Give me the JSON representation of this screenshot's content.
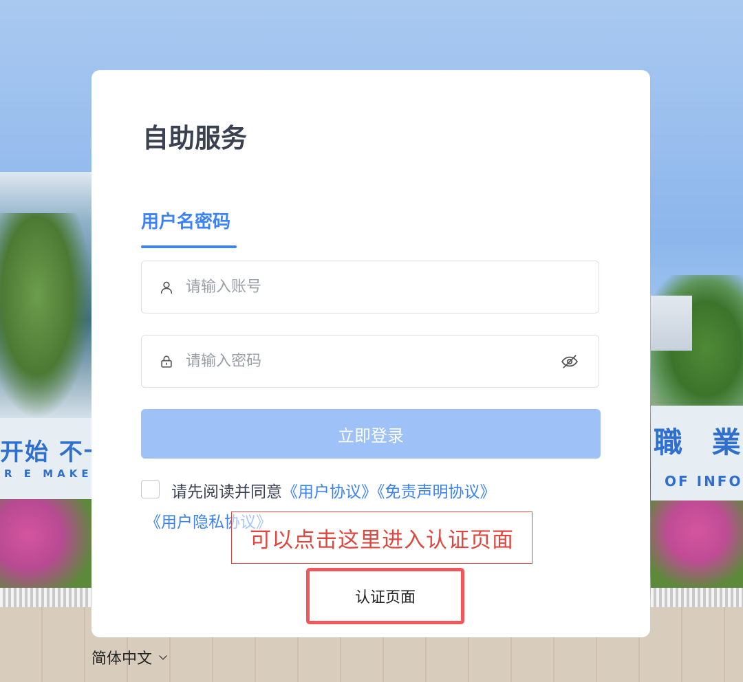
{
  "background": {
    "sign_left_big": "开始 不一",
    "sign_left_small": "R E  MAKE",
    "sign_right_big": "職 業",
    "sign_right_small": "OF  INFO"
  },
  "card": {
    "title": "自助服务",
    "tab_label": "用户名密码",
    "username": {
      "placeholder": "请输入账号",
      "icon": "user-icon"
    },
    "password": {
      "placeholder": "请输入密码",
      "icon": "lock-icon",
      "toggle_icon": "eye-off-icon"
    },
    "login_button": "立即登录",
    "agreement": {
      "prefix": "请先阅读并同意",
      "user_agreement": "《用户协议》",
      "disclaimer": "《免责声明协议》",
      "privacy": "《用户隐私协议》"
    },
    "annotation": "可以点击这里进入认证页面",
    "cert_button": "认证页面"
  },
  "language": {
    "label": "简体中文",
    "icon": "chevron-down-icon"
  },
  "colors": {
    "accent": "#3b82f6",
    "login_button_bg": "#9ec2f7",
    "annotation_red": "#e0463d",
    "cert_border": "#f0575b"
  }
}
